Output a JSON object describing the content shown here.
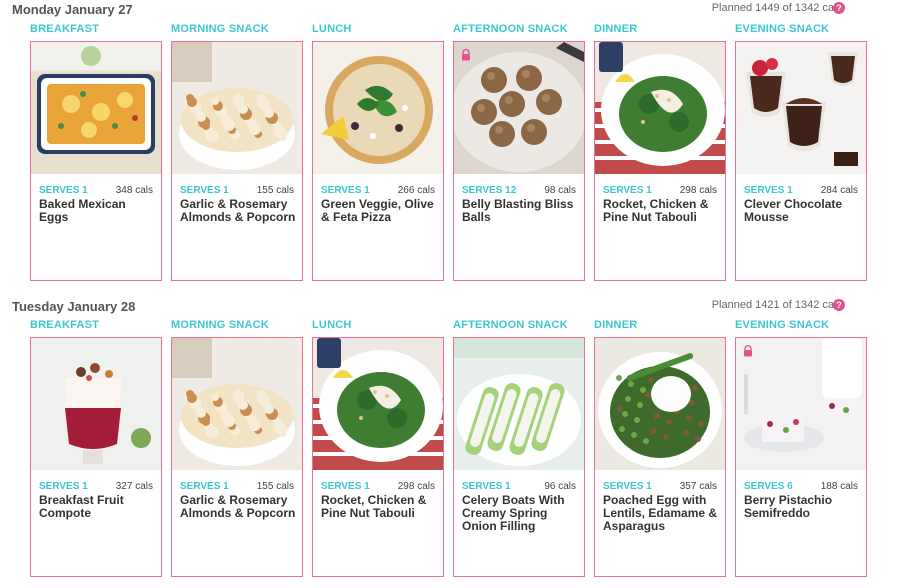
{
  "days": [
    {
      "title": "Monday January 27",
      "planned": "Planned 1449 of 1342 cals",
      "meals": [
        {
          "label": "BREAKFAST",
          "serves": "SERVES 1",
          "cals": "348 cals",
          "title": "Baked Mexican Eggs",
          "locked": false,
          "image": "baked-eggs"
        },
        {
          "label": "MORNING SNACK",
          "serves": "SERVES 1",
          "cals": "155 cals",
          "title": "Garlic & Rosemary Almonds & Popcorn",
          "locked": false,
          "image": "popcorn"
        },
        {
          "label": "LUNCH",
          "serves": "SERVES 1",
          "cals": "266 cals",
          "title": "Green Veggie, Olive & Feta Pizza",
          "locked": false,
          "image": "pizza"
        },
        {
          "label": "AFTERNOON SNACK",
          "serves": "SERVES 12",
          "cals": "98 cals",
          "title": "Belly Blasting Bliss Balls",
          "locked": true,
          "image": "bliss-balls"
        },
        {
          "label": "DINNER",
          "serves": "SERVES 1",
          "cals": "298 cals",
          "title": "Rocket, Chicken & Pine Nut Tabouli",
          "locked": false,
          "image": "tabouli"
        },
        {
          "label": "EVENING SNACK",
          "serves": "SERVES 1",
          "cals": "284 cals",
          "title": "Clever Chocolate Mousse",
          "locked": false,
          "image": "mousse"
        }
      ]
    },
    {
      "title": "Tuesday January 28",
      "planned": "Planned 1421 of 1342 cals",
      "meals": [
        {
          "label": "BREAKFAST",
          "serves": "SERVES 1",
          "cals": "327 cals",
          "title": "Breakfast Fruit Compote",
          "locked": false,
          "image": "compote"
        },
        {
          "label": "MORNING SNACK",
          "serves": "SERVES 1",
          "cals": "155 cals",
          "title": "Garlic & Rosemary Almonds & Popcorn",
          "locked": false,
          "image": "popcorn"
        },
        {
          "label": "LUNCH",
          "serves": "SERVES 1",
          "cals": "298 cals",
          "title": "Rocket, Chicken & Pine Nut Tabouli",
          "locked": false,
          "image": "tabouli"
        },
        {
          "label": "AFTERNOON SNACK",
          "serves": "SERVES 1",
          "cals": "96 cals",
          "title": "Celery Boats With Creamy Spring Onion Filling",
          "locked": false,
          "image": "celery"
        },
        {
          "label": "DINNER",
          "serves": "SERVES 1",
          "cals": "357 cals",
          "title": "Poached Egg with Lentils, Edamame & Asparagus",
          "locked": false,
          "image": "poached-egg"
        },
        {
          "label": "EVENING SNACK",
          "serves": "SERVES 6",
          "cals": "188 cals",
          "title": "Berry Pistachio Semifreddo",
          "locked": true,
          "image": "semifreddo"
        }
      ]
    }
  ],
  "help_icon": "?",
  "colors": {
    "accent": "#3cc7d0",
    "border": "#e9709c",
    "help": "#e6508c"
  }
}
